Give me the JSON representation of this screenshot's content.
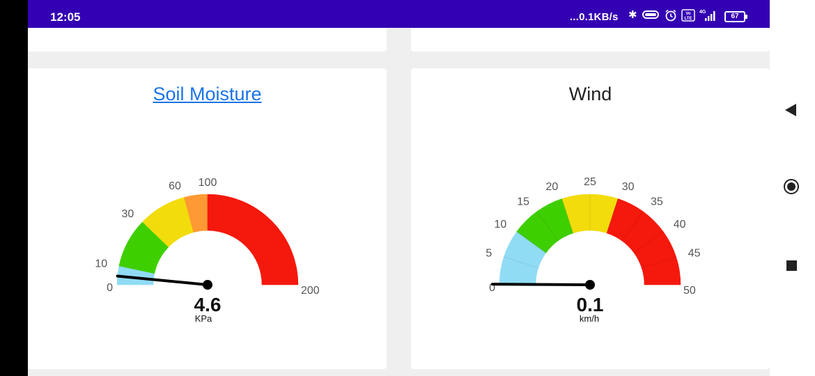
{
  "status_bar": {
    "time": "12:05",
    "net_speed": "...0.1KB/s",
    "battery": "67",
    "network": "4G",
    "volte": "VoLTE",
    "icons": [
      "bluetooth-icon",
      "toggle-icon",
      "alarm-icon",
      "volte-icon",
      "signal-icon",
      "battery-icon"
    ]
  },
  "cards": {
    "soil": {
      "title": "Soil Moisture",
      "value": "4.6",
      "unit": "KPa"
    },
    "wind": {
      "title": "Wind",
      "value": "0.1",
      "unit": "km/h"
    }
  },
  "gauges": {
    "soil": {
      "min": 0,
      "max": 200,
      "value": 4.6,
      "ticks": [
        "0",
        "10",
        "30",
        "60",
        "100",
        "200"
      ],
      "bands": [
        {
          "from": 0,
          "to": 10,
          "color": "#90dcf5"
        },
        {
          "from": 10,
          "to": 30,
          "color": "#3ecf00"
        },
        {
          "from": 30,
          "to": 60,
          "color": "#f2dc0c"
        },
        {
          "from": 60,
          "to": 100,
          "color": "#ff9933"
        },
        {
          "from": 100,
          "to": 200,
          "color": "#f5180c"
        }
      ]
    },
    "wind": {
      "min": 0,
      "max": 50,
      "value": 0.1,
      "ticks": [
        "0",
        "5",
        "10",
        "15",
        "20",
        "25",
        "30",
        "35",
        "40",
        "45",
        "50"
      ],
      "bands": [
        {
          "from": 0,
          "to": 10,
          "color": "#90dcf5"
        },
        {
          "from": 10,
          "to": 20,
          "color": "#3ecf00"
        },
        {
          "from": 20,
          "to": 30,
          "color": "#f2dc0c"
        },
        {
          "from": 30,
          "to": 50,
          "color": "#f5180c"
        }
      ]
    }
  },
  "nav": {
    "back": "back-icon",
    "home": "home-icon",
    "recents": "recents-icon"
  }
}
